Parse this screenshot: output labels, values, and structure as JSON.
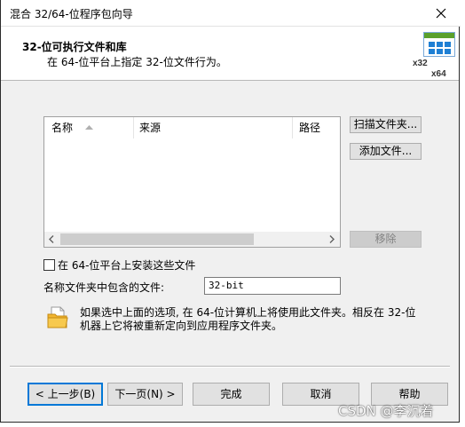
{
  "window": {
    "title": "混合 32/64-位程序包向导"
  },
  "header": {
    "title": "32-位可执行文件和库",
    "subtitle": "在 64-位平台上指定 32-位文件行为。",
    "icon_label_x32": "x32",
    "icon_label_x64": "x64"
  },
  "list": {
    "columns": [
      "名称",
      "来源",
      "路径"
    ],
    "rows": []
  },
  "side_buttons": {
    "scan_folder": "扫描文件夹...",
    "add_file": "添加文件...",
    "remove": "移除"
  },
  "options": {
    "install_on_64_label": "在 64-位平台上安装这些文件",
    "install_on_64_checked": false,
    "folder_label": "名称文件夹中包含的文件:",
    "folder_value": "32-bit"
  },
  "info": {
    "text": "如果选中上面的选项, 在 64-位计算机上将使用此文件夹。相反在 32-位机器上它将被重新定向到应用程序文件夹。"
  },
  "footer": {
    "back": "< 上一步(B)",
    "next": "下一页(N) >",
    "finish": "完成",
    "cancel": "取消",
    "help": "帮助"
  },
  "watermark": "CSDN @李沉着",
  "colors": {
    "accent": "#0078d7",
    "icon_green": "#5aa02c",
    "icon_blue": "#1e7fd4",
    "folder_yellow": "#f2b530"
  }
}
